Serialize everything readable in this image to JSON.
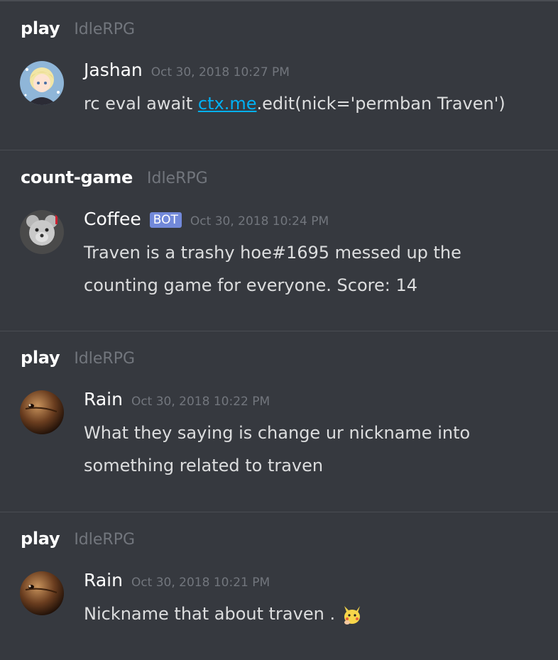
{
  "sections": [
    {
      "channel": "play",
      "server": "IdleRPG",
      "author": "Jashan",
      "timestamp": "Oct 30, 2018 10:27 PM",
      "content_prefix": "rc eval await ",
      "content_link": "ctx.me",
      "content_suffix": ".edit(nick='permban Traven')"
    },
    {
      "channel": "count-game",
      "server": "IdleRPG",
      "author": "Coffee",
      "bot_tag": "BOT",
      "timestamp": "Oct 30, 2018 10:24 PM",
      "content": "Traven is a trashy hoe#1695 messed up the counting game for everyone. Score: 14"
    },
    {
      "channel": "play",
      "server": "IdleRPG",
      "author": "Rain",
      "timestamp": "Oct 30, 2018 10:22 PM",
      "content": "What they saying is change ur nickname into something related to traven"
    },
    {
      "channel": "play",
      "server": "IdleRPG",
      "author": "Rain",
      "timestamp": "Oct 30, 2018 10:21 PM",
      "content": "Nickname that about traven .",
      "emoji": "thinking-pikachu-emoji"
    }
  ],
  "colors": {
    "background": "#36393f",
    "divider": "#4a4d53",
    "link": "#00b0f4",
    "bot_tag": "#7289da",
    "timestamp": "#72767d"
  }
}
